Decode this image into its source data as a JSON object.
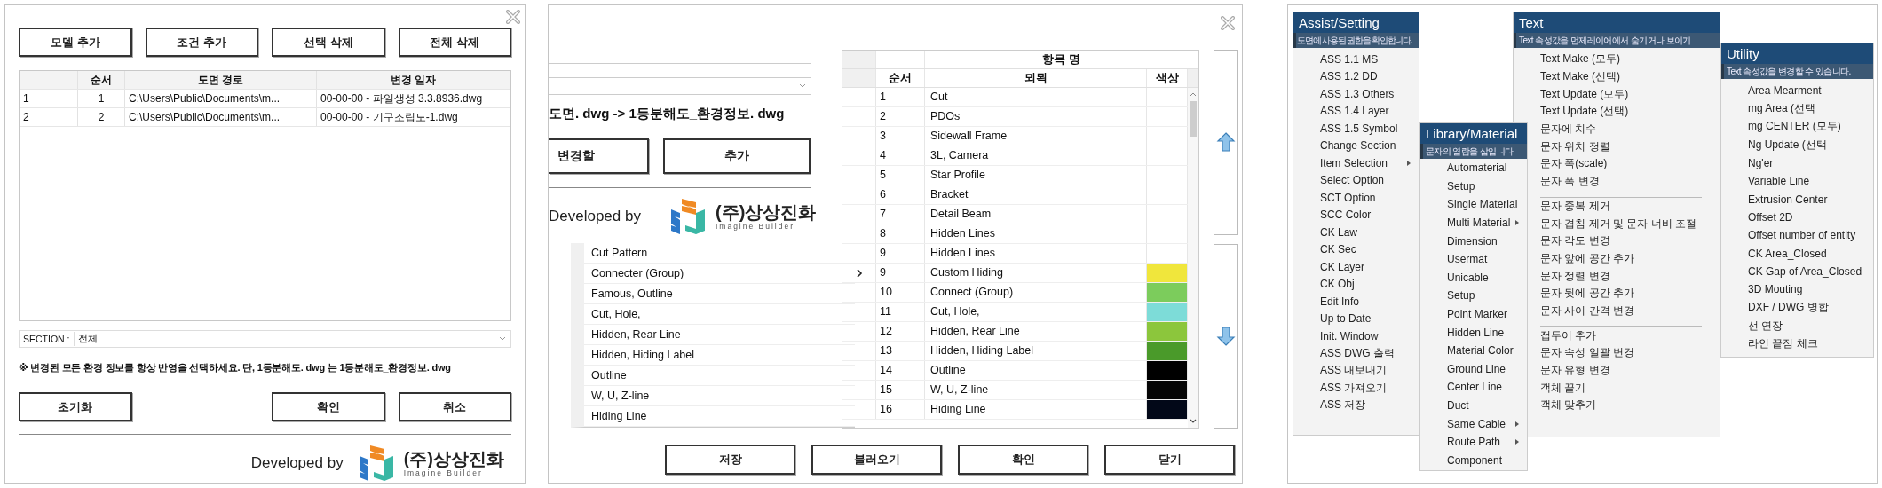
{
  "file_dialog": {
    "toolbar": [
      "모델 추가",
      "조건 추가",
      "선택 삭제",
      "전체 삭제"
    ],
    "table": {
      "columns": [
        "순서",
        "도면 경로",
        "변경 일자"
      ],
      "rows": [
        {
          "index": "1",
          "order": "1",
          "path": "C:\\Users\\Public\\Documents\\m...",
          "changed": "00-00-00 - 파일생성 3.3.8936.dwg"
        },
        {
          "index": "2",
          "order": "2",
          "path": "C:\\Users\\Public\\Documents\\m...",
          "changed": "00-00-00 - 기구조립도-1.dwg"
        }
      ]
    },
    "section": {
      "label": "SECTION :",
      "value": "전체"
    },
    "note": "※ 변경된 모든 환경 정보를 항상 반영을 선택하세요.  단, 1등분해도. dwg 는 1등분해도_환경정보. dwg",
    "reset_button": "초기화",
    "dialog_buttons": [
      "확인",
      "취소"
    ],
    "developer": {
      "label": "Developed by",
      "company": "(주)상상진화",
      "tagline": "Imagine Builder"
    }
  },
  "layer_dialog": {
    "path_text": "도면. dwg -> 1등분해도_환경정보. dwg",
    "buttons": [
      "변경할",
      "추가"
    ],
    "developer": {
      "label": "Developed by",
      "company": "(주)상상진화",
      "tagline": "Imagine Builder"
    },
    "list": [
      "Cut Pattern",
      "Connecter (Group)",
      "Famous, Outline",
      "Cut, Hole,",
      "Hidden, Rear Line",
      "Hidden, Hiding Label",
      "Outline",
      "W, U, Z-line",
      "Hiding Line"
    ],
    "table": {
      "group_header": "항목 명",
      "columns": [
        "순서",
        "뫼뫽",
        "색상"
      ],
      "rows": [
        {
          "no": "1",
          "name": "Cut",
          "current": false
        },
        {
          "no": "2",
          "name": "PDOs",
          "current": false
        },
        {
          "no": "3",
          "name": "Sidewall Frame",
          "current": false
        },
        {
          "no": "4",
          "name": "3L, Camera",
          "current": false
        },
        {
          "no": "5",
          "name": "Star Profile",
          "current": false
        },
        {
          "no": "6",
          "name": "Bracket",
          "current": false
        },
        {
          "no": "7",
          "name": "Detail Beam",
          "current": false
        },
        {
          "no": "8",
          "name": "Hidden Lines",
          "current": false
        },
        {
          "no": "9",
          "name": "Hidden Lines",
          "current": false
        },
        {
          "no": "9",
          "name": "Custom Hiding",
          "current": true,
          "color": "#f0e63c"
        },
        {
          "no": "10",
          "name": "Connect (Group)",
          "current": false,
          "color": "#7ccc5c"
        },
        {
          "no": "11",
          "name": "Cut, Hole,",
          "current": false,
          "color": "#7ddcd8"
        },
        {
          "no": "12",
          "name": "Hidden, Rear Line",
          "current": false,
          "color": "#8cc63c"
        },
        {
          "no": "13",
          "name": "Hidden, Hiding Label",
          "current": false,
          "color": "#4a9a2a"
        },
        {
          "no": "14",
          "name": "Outline",
          "current": false,
          "color": "#000000"
        },
        {
          "no": "15",
          "name": "W, U, Z-line",
          "current": false,
          "color": "#050505"
        },
        {
          "no": "16",
          "name": "Hiding Line",
          "current": false,
          "color": "#020818"
        }
      ]
    },
    "footer_buttons": [
      "저장",
      "불러오기",
      "확인",
      "닫기"
    ]
  },
  "menus": [
    {
      "title": "Assist/Setting",
      "subtitle": "도면에 사용된 권한을 확인합니다.",
      "items": [
        {
          "kind": "item",
          "label": "ASS 1.1 MS"
        },
        {
          "kind": "item",
          "label": "ASS 1.2 DD"
        },
        {
          "kind": "item",
          "label": "ASS 1.3 Others"
        },
        {
          "kind": "item",
          "label": "ASS 1.4 Layer"
        },
        {
          "kind": "item",
          "label": "ASS 1.5 Symbol"
        },
        {
          "kind": "item",
          "label": "Change Section"
        },
        {
          "kind": "submenu",
          "label": "Item Selection"
        },
        {
          "kind": "item",
          "label": "Select Option"
        },
        {
          "kind": "item",
          "label": "SCT Option"
        },
        {
          "kind": "item",
          "label": "SCC Color"
        },
        {
          "kind": "item",
          "label": "CK Law"
        },
        {
          "kind": "item",
          "label": "CK Sec"
        },
        {
          "kind": "item",
          "label": "CK Layer"
        },
        {
          "kind": "item",
          "label": "CK Obj"
        },
        {
          "kind": "item",
          "label": "Edit Info"
        },
        {
          "kind": "item",
          "label": "Up to Date"
        },
        {
          "kind": "item",
          "label": "Init. Window"
        },
        {
          "kind": "item",
          "label": "ASS DWG 출력"
        },
        {
          "kind": "item",
          "label": "ASS 내보내기"
        },
        {
          "kind": "item",
          "label": "ASS 가져오기"
        },
        {
          "kind": "item",
          "label": "ASS 저장"
        }
      ]
    },
    {
      "title": "Library/Material",
      "subtitle": "문자의 열람을 삽입니다",
      "items": [
        {
          "kind": "item",
          "label": "Automaterial"
        },
        {
          "kind": "item",
          "label": "Setup"
        },
        {
          "kind": "item",
          "label": "Single Material"
        },
        {
          "kind": "submenu",
          "label": "Multi Material"
        },
        {
          "kind": "item",
          "label": "Dimension"
        },
        {
          "kind": "item",
          "label": "Usermat"
        },
        {
          "kind": "item",
          "label": "Unicable"
        },
        {
          "kind": "item",
          "label": "Setup"
        },
        {
          "kind": "item",
          "label": "Point Marker"
        },
        {
          "kind": "item",
          "label": "Hidden Line"
        },
        {
          "kind": "item",
          "label": "Material Color"
        },
        {
          "kind": "item",
          "label": "Ground Line"
        },
        {
          "kind": "item",
          "label": "Center Line"
        },
        {
          "kind": "item",
          "label": "Duct"
        },
        {
          "kind": "submenu",
          "label": "Same Cable"
        },
        {
          "kind": "submenu",
          "label": "Route Path"
        },
        {
          "kind": "item",
          "label": "Component"
        }
      ]
    },
    {
      "title": "Text",
      "subtitle": "Text 속성값을 먼제레이어에서 숨기거나 보이기",
      "items": [
        {
          "kind": "item",
          "label": "Text Make (모두)"
        },
        {
          "kind": "item",
          "label": "Text Make (선택)"
        },
        {
          "kind": "item",
          "label": "Text Update (모두)"
        },
        {
          "kind": "item",
          "label": "Text Update (선택)"
        },
        {
          "kind": "item",
          "label": "문자에 치수"
        },
        {
          "kind": "item",
          "label": "문자 위치 정렬"
        },
        {
          "kind": "item",
          "label": "문자 폭(scale)"
        },
        {
          "kind": "item",
          "label": "문자 폭 변경"
        },
        {
          "kind": "separator"
        },
        {
          "kind": "item",
          "label": "문자 중복 제거"
        },
        {
          "kind": "item",
          "label": "문자 겹침 제거 및 문자 너비 조절"
        },
        {
          "kind": "item",
          "label": "문자 각도 변경"
        },
        {
          "kind": "item",
          "label": "문자 앞에 공간 추가"
        },
        {
          "kind": "item",
          "label": "문자 정렬 변경"
        },
        {
          "kind": "item",
          "label": "문자 뒷에 공간 추가"
        },
        {
          "kind": "item",
          "label": "문자 사이 간격 변경"
        },
        {
          "kind": "separator"
        },
        {
          "kind": "item",
          "label": "접두어 추가"
        },
        {
          "kind": "item",
          "label": "문자 속성 일괄 변경"
        },
        {
          "kind": "item",
          "label": "문자 유형 변경"
        },
        {
          "kind": "item",
          "label": "객체 끌기"
        },
        {
          "kind": "item",
          "label": "객체 맞추기"
        }
      ]
    },
    {
      "title": "Utility",
      "subtitle": "Text 속성값을 변경할 수 있습니다.",
      "items": [
        {
          "kind": "item",
          "label": "Area Mearment"
        },
        {
          "kind": "item",
          "label": "mg Area (선택"
        },
        {
          "kind": "item",
          "label": "mg CENTER (모두)"
        },
        {
          "kind": "item",
          "label": "Ng Update (선택"
        },
        {
          "kind": "item",
          "label": "Ng'er"
        },
        {
          "kind": "item",
          "label": "Variable Line"
        },
        {
          "kind": "item",
          "label": "Extrusion Center"
        },
        {
          "kind": "item",
          "label": "Offset 2D"
        },
        {
          "kind": "item",
          "label": "Offset number of entity"
        },
        {
          "kind": "item",
          "label": "CK Area_Closed"
        },
        {
          "kind": "item",
          "label": "CK Gap of Area_Closed"
        },
        {
          "kind": "item",
          "label": "3D Mouting"
        },
        {
          "kind": "item",
          "label": "DXF / DWG 병합"
        },
        {
          "kind": "item",
          "label": "선 연장"
        },
        {
          "kind": "item",
          "label": "라인 끝점 체크"
        }
      ]
    }
  ]
}
